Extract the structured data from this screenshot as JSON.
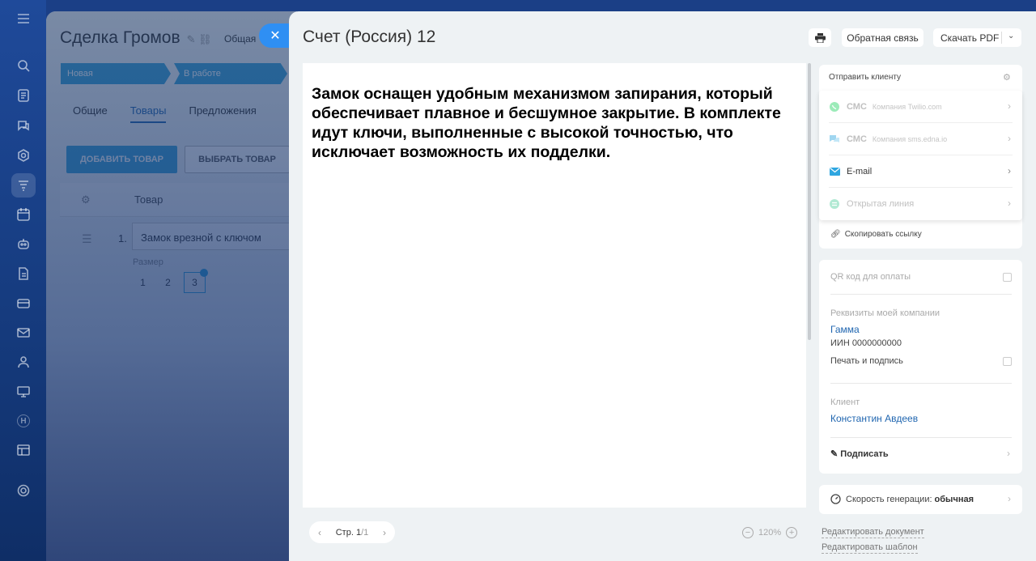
{
  "deal": {
    "title": "Сделка Громов",
    "category": "Общая",
    "stages": [
      "Новая",
      "В работе"
    ],
    "tabs": [
      "Общие",
      "Товары",
      "Предложения"
    ],
    "add_product": "ДОБАВИТЬ ТОВАР",
    "select_product": "ВЫБРАТЬ ТОВАР",
    "grid_header_product": "Товар",
    "row_number": "1.",
    "row_product": "Замок врезной с ключом",
    "size_label": "Размер",
    "sizes": [
      "1",
      "2",
      "3"
    ]
  },
  "panel": {
    "title": "Счет (Россия) 12",
    "feedback_label": "Обратная связь",
    "download_pdf_label": "Скачать PDF",
    "document_text": "Замок оснащен удобным механизмом запирания, который обеспечивает плавное и бесшумное закрытие. В комплекте идут ключи, выполненные с высокой точностью, что исключает возможность их подделки.",
    "pager": {
      "prefix": "Стр. ",
      "current": "1",
      "total": "/1"
    },
    "zoom": "120%"
  },
  "send": {
    "title": "Отправить клиенту",
    "items": [
      {
        "name": "СМС",
        "sub": "Компания Twilio.com"
      },
      {
        "name": "СМС",
        "sub": "Компания sms.edna.io"
      },
      {
        "name": "E-mail",
        "sub": ""
      },
      {
        "name": "Открытая линия",
        "sub": ""
      }
    ],
    "copy_link": "Скопировать ссылку"
  },
  "info": {
    "qr_label": "QR код для оплаты",
    "company_label": "Реквизиты моей компании",
    "company_name": "Гамма",
    "company_inn": "ИИН 0000000000",
    "print_sign_label": "Печать и подпись",
    "client_label": "Клиент",
    "client_name": "Константин Авдеев",
    "sign_label": "Подписать"
  },
  "speed": {
    "label": "Скорость генерации:",
    "value": "обычная"
  },
  "links": {
    "edit_document": "Редактировать документ",
    "edit_template": "Редактировать шаблон"
  },
  "colors": {
    "accent": "#2066b0",
    "stage": "#3aa3d8",
    "close": "#2f8ff3",
    "email": "#2fa6e0",
    "whatsapp": "#25d366"
  }
}
